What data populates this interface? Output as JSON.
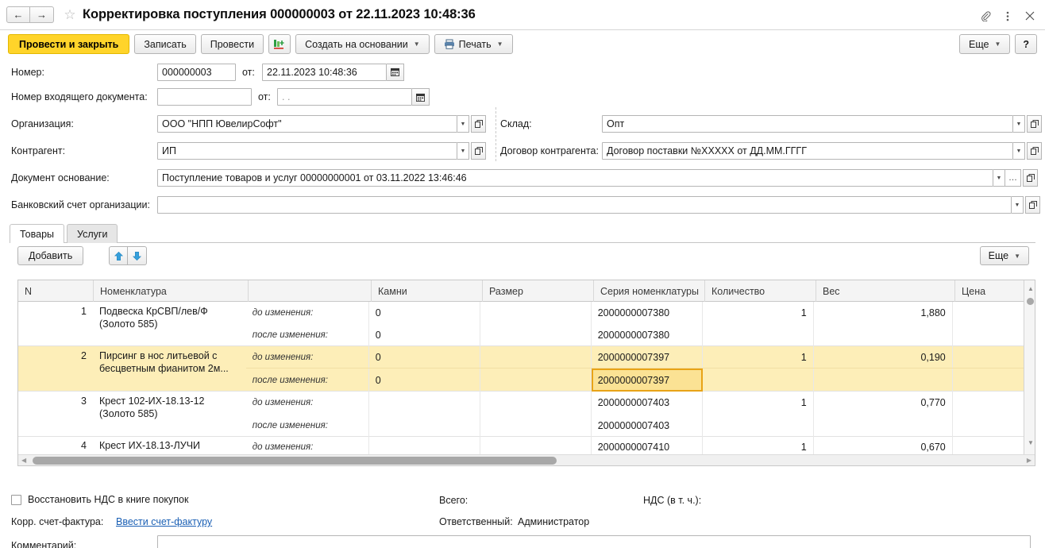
{
  "window": {
    "title": "Корректировка поступления 000000003 от 22.11.2023 10:48:36",
    "back_icon": "←",
    "forward_icon": "→",
    "favorite_icon": "☆",
    "attach_icon": "paperclip-icon",
    "menu_icon": "⋮",
    "close_icon": "✕"
  },
  "commandbar": {
    "post_and_close": "Провести и закрыть",
    "write": "Записать",
    "post": "Провести",
    "create_based_on": "Создать на основании",
    "print": "Печать",
    "more": "Еще",
    "help": "?"
  },
  "form": {
    "number_label": "Номер:",
    "number_value": "000000003",
    "date_prefix": "от:",
    "date_value": "22.11.2023 10:48:36",
    "incoming_label": "Номер входящего документа:",
    "incoming_value": "",
    "incoming_date_prefix": "от:",
    "incoming_date_value": ".   .",
    "organization_label": "Организация:",
    "organization_value": "ООО \"НПП ЮвелирСофт\"",
    "warehouse_label": "Склад:",
    "warehouse_value": "Опт",
    "counterparty_label": "Контрагент:",
    "counterparty_value": "ИП",
    "contract_label": "Договор контрагента:",
    "contract_value": "Договор поставки №XXXXX от ДД.ММ.ГГГГ",
    "basis_doc_label": "Документ основание:",
    "basis_doc_value": "Поступление товаров и услуг 00000000001 от 03.11.2022 13:46:46",
    "bank_account_label": "Банковский счет организации:",
    "bank_account_value": ""
  },
  "tabs": [
    {
      "label": "Товары",
      "active": true
    },
    {
      "label": "Услуги",
      "active": false
    }
  ],
  "table_toolbar": {
    "add": "Добавить",
    "move_up_icon": "arrow-up-icon",
    "move_down_icon": "arrow-down-icon",
    "more": "Еще"
  },
  "table": {
    "columns": [
      "N",
      "Номенклатура",
      "",
      "Камни",
      "Размер",
      "Серия номенклатуры",
      "Количество",
      "Вес",
      "Цена"
    ],
    "before_label": "до изменения:",
    "after_label": "после изменения:",
    "rows": [
      {
        "n": "1",
        "name": "Подвеска КрСВП/лев/Ф (Золото 585)",
        "selected": false,
        "before": {
          "stones": "0",
          "size": "",
          "series": "2000000007380",
          "qty": "1",
          "weight": "1,880",
          "price": ""
        },
        "after": {
          "stones": "0",
          "size": "",
          "series": "2000000007380",
          "qty": "",
          "weight": "",
          "price": ""
        }
      },
      {
        "n": "2",
        "name": "Пирсинг в нос литьевой с бесцветным фианитом 2м...",
        "selected": true,
        "before": {
          "stones": "0",
          "size": "",
          "series": "2000000007397",
          "qty": "1",
          "weight": "0,190",
          "price": ""
        },
        "after": {
          "stones": "0",
          "size": "",
          "series": "2000000007397",
          "qty": "",
          "weight": "",
          "price": "",
          "series_focused": true
        }
      },
      {
        "n": "3",
        "name": "Крест 102-ИХ-18.13-12 (Золото 585)",
        "selected": false,
        "before": {
          "stones": "",
          "size": "",
          "series": "2000000007403",
          "qty": "1",
          "weight": "0,770",
          "price": ""
        },
        "after": {
          "stones": "",
          "size": "",
          "series": "2000000007403",
          "qty": "",
          "weight": "",
          "price": ""
        }
      },
      {
        "n": "4",
        "name": "Крест ИХ-18.13-ЛУЧИ",
        "selected": false,
        "before": {
          "stones": "",
          "size": "",
          "series": "2000000007410",
          "qty": "1",
          "weight": "0,670",
          "price": ""
        },
        "after": {
          "stones": "",
          "size": "",
          "series": "",
          "qty": "",
          "weight": "",
          "price": ""
        }
      }
    ]
  },
  "footer": {
    "restore_vat_label": "Восстановить НДС в книге покупок",
    "restore_vat_checked": false,
    "total_label": "Всего:",
    "total_value": "",
    "vat_label": "НДС (в т. ч.):",
    "vat_value": "",
    "invoice_label": "Корр. счет-фактура:",
    "invoice_link": "Ввести счет-фактуру",
    "responsible_label": "Ответственный:",
    "responsible_value": "Администратор",
    "comment_label": "Комментарий:",
    "comment_value": ""
  },
  "colors": {
    "accent_yellow": "#ffd42a",
    "selected_row": "#fdeeb8",
    "focus_border": "#e8a317",
    "link": "#1a5fb4"
  }
}
